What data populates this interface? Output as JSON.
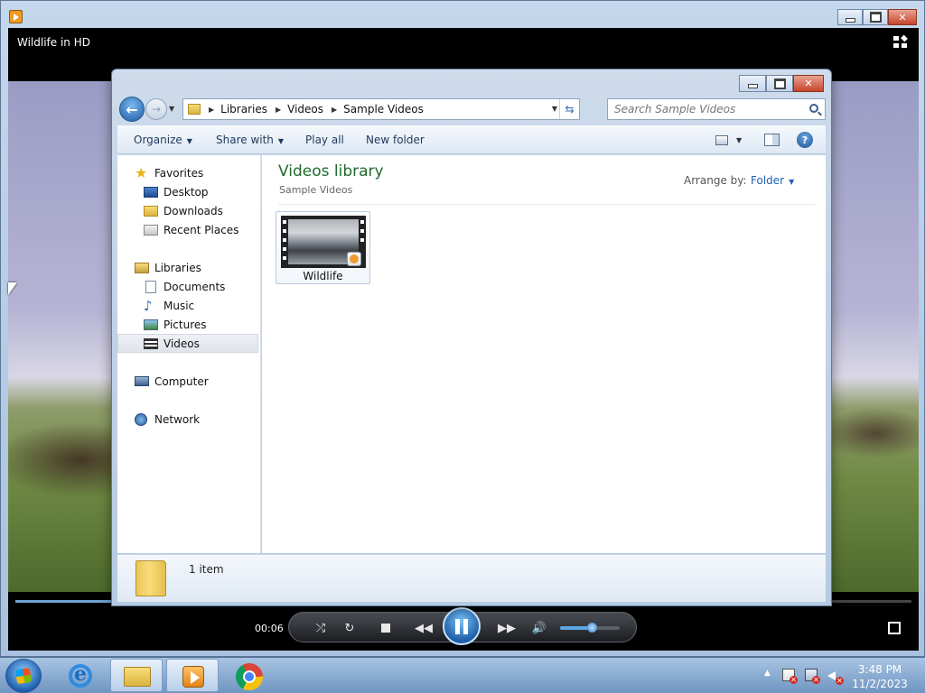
{
  "media_player": {
    "video_title": "Wildlife in HD",
    "elapsed_time": "00:06",
    "seek_progress_percent": 11,
    "volume_percent": 55
  },
  "explorer": {
    "breadcrumbs": [
      "Libraries",
      "Videos",
      "Sample Videos"
    ],
    "search_placeholder": "Search Sample Videos",
    "toolbar": {
      "organize": "Organize",
      "share_with": "Share with",
      "play_all": "Play all",
      "new_folder": "New folder"
    },
    "nav": {
      "favorites": "Favorites",
      "desktop": "Desktop",
      "downloads": "Downloads",
      "recent_places": "Recent Places",
      "libraries": "Libraries",
      "documents": "Documents",
      "music": "Music",
      "pictures": "Pictures",
      "videos": "Videos",
      "computer": "Computer",
      "network": "Network"
    },
    "library_title": "Videos library",
    "library_subtitle": "Sample Videos",
    "arrange_label": "Arrange by:",
    "arrange_value": "Folder",
    "files": [
      {
        "name": "Wildlife"
      }
    ],
    "item_count": "1 item"
  },
  "taskbar": {
    "clock_time": "3:48 PM",
    "clock_date": "11/2/2023"
  },
  "colors": {
    "library_title": "#1e6b2e",
    "link_blue": "#2262b4",
    "close_button": "#c8442b"
  }
}
